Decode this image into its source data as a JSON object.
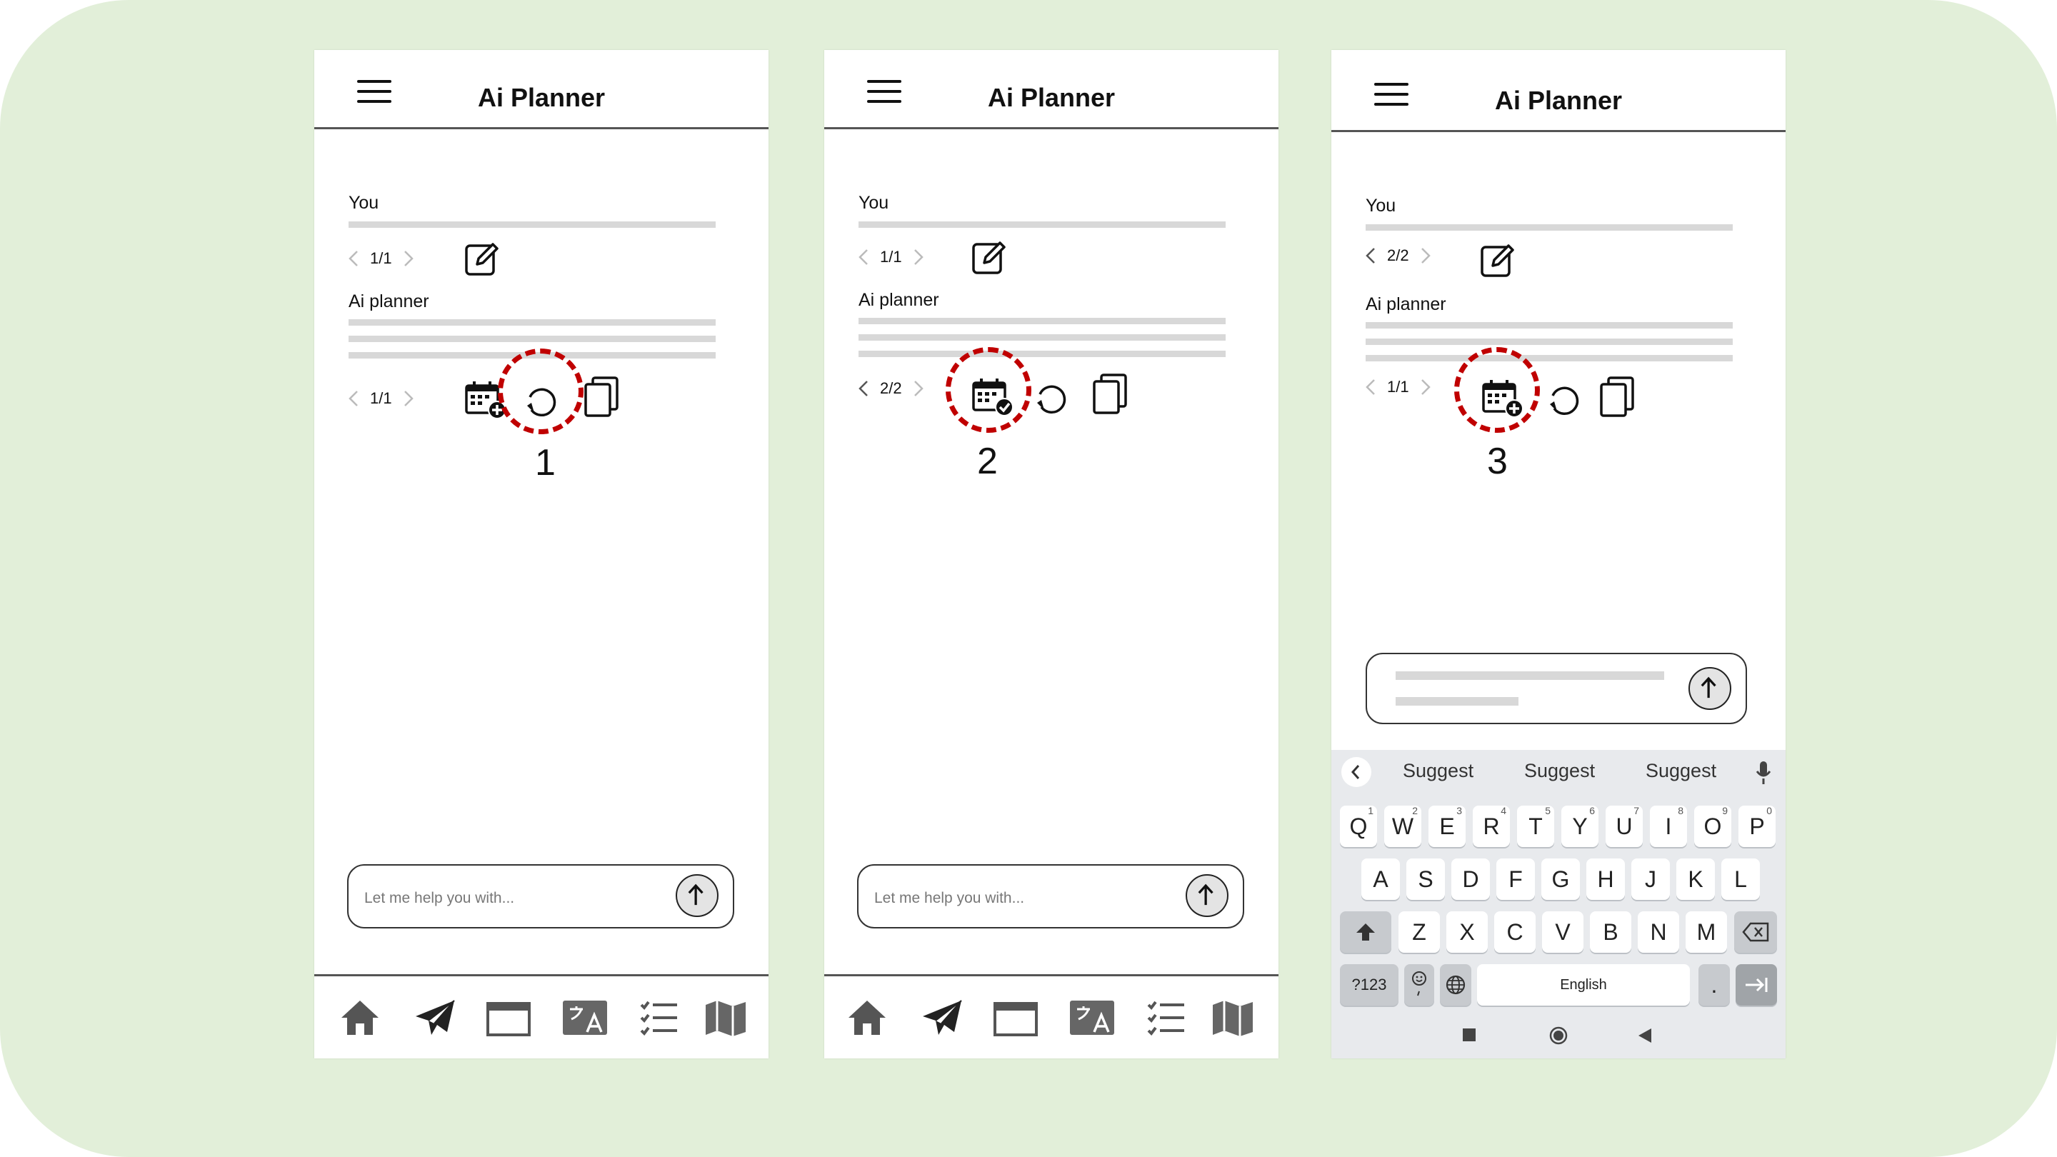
{
  "app_title": "Ai Planner",
  "conversation": {
    "you_label": "You",
    "ai_label": "Ai planner"
  },
  "screens": [
    {
      "user_pager": "1/1",
      "ai_pager": "1/1",
      "step": "1",
      "input_placeholder": "Let me help you with..."
    },
    {
      "user_pager": "1/1",
      "ai_pager": "2/2",
      "step": "2",
      "input_placeholder": "Let me help you with..."
    },
    {
      "user_pager": "2/2",
      "ai_pager": "1/1",
      "step": "3"
    }
  ],
  "keyboard": {
    "suggestions": [
      "Suggest",
      "Suggest",
      "Suggest"
    ],
    "row1": [
      "Q",
      "W",
      "E",
      "R",
      "T",
      "Y",
      "U",
      "I",
      "O",
      "P"
    ],
    "row1_hints": [
      "1",
      "2",
      "3",
      "4",
      "5",
      "6",
      "7",
      "8",
      "9",
      "0"
    ],
    "row2": [
      "A",
      "S",
      "D",
      "F",
      "G",
      "H",
      "J",
      "K",
      "L"
    ],
    "row3": [
      "Z",
      "X",
      "C",
      "V",
      "B",
      "N",
      "M"
    ],
    "symbols_key": "?123",
    "space_label": "English",
    "period_key": "."
  },
  "colors": {
    "background": "#e2efd9",
    "highlight": "#c00000"
  },
  "icons": {
    "menu": "hamburger-icon",
    "edit": "edit-icon",
    "add_to_calendar": "calendar-add-icon",
    "added_to_calendar": "calendar-check-icon",
    "regenerate": "refresh-icon",
    "copy": "copy-icon",
    "send": "send-arrow-icon",
    "nav": [
      "home-icon",
      "send-plane-icon",
      "calendar-icon",
      "translate-icon",
      "list-icon",
      "map-icon"
    ]
  }
}
